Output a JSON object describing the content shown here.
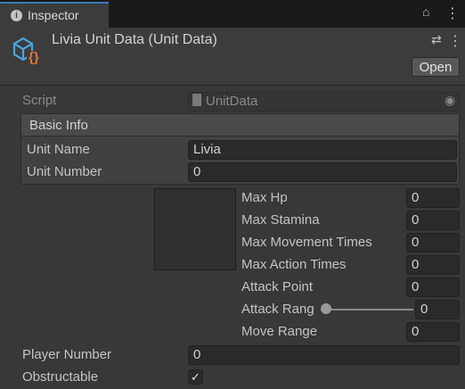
{
  "tab": {
    "label": "Inspector",
    "info_glyph": "i",
    "lock_glyph": "⌂",
    "menu_glyph": "⋮"
  },
  "header": {
    "title": "Livia Unit Data (Unit Data)",
    "asset_icon_badge": "{}",
    "settings_glyph": "⇄",
    "menu_glyph": "⋮",
    "open_label": "Open"
  },
  "script": {
    "label": "Script",
    "value": "UnitData",
    "target_glyph": "◉"
  },
  "basic_info": {
    "heading": "Basic Info",
    "unit_name_label": "Unit Name",
    "unit_name_value": "Livia",
    "unit_number_label": "Unit Number",
    "unit_number_value": "0"
  },
  "stats": {
    "max_hp_label": "Max Hp",
    "max_hp_value": "0",
    "max_stamina_label": "Max Stamina",
    "max_stamina_value": "0",
    "max_movement_label": "Max Movement Times",
    "max_movement_value": "0",
    "max_action_label": "Max Action Times",
    "max_action_value": "0",
    "attack_point_label": "Attack Point",
    "attack_point_value": "0",
    "attack_range_label": "Attack Rang",
    "attack_range_value": "0",
    "move_range_label": "Move Range",
    "move_range_value": "0"
  },
  "player_number": {
    "label": "Player Number",
    "value": "0"
  },
  "obstructable": {
    "label": "Obstructable",
    "checked_glyph": "✓"
  },
  "colors": {
    "accent": "#3a79bb",
    "icon_blue": "#4aa3df",
    "icon_orange": "#e8743b"
  }
}
